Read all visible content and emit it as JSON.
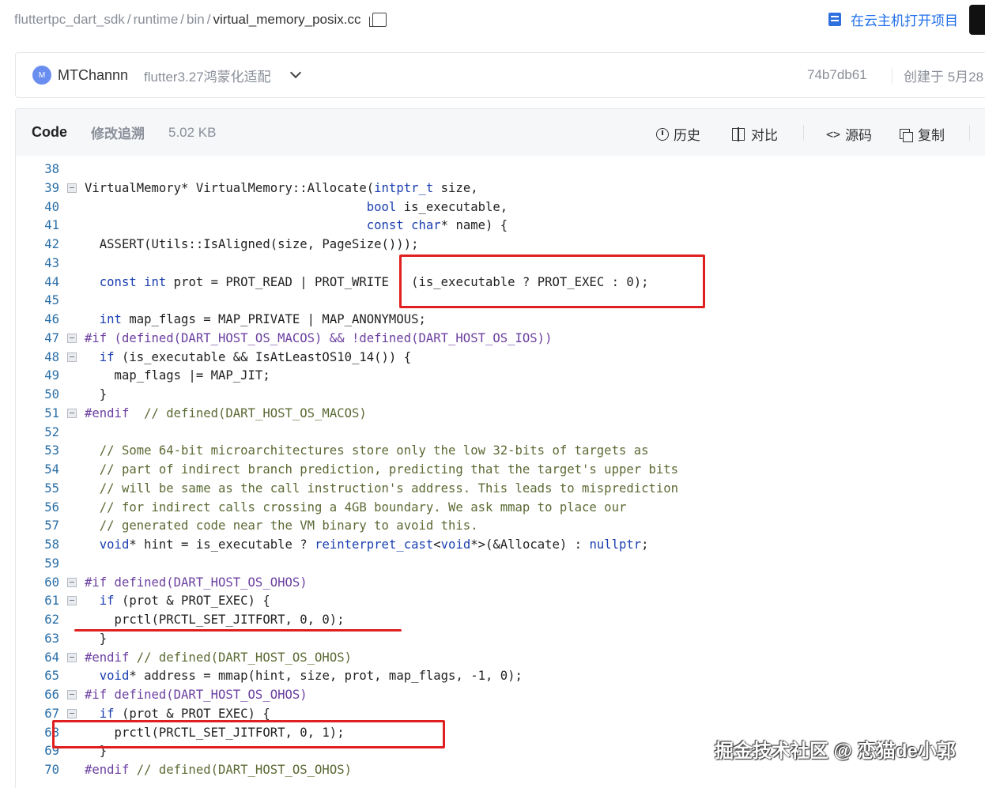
{
  "breadcrumb": [
    "fluttertpc_dart_sdk",
    "runtime",
    "bin"
  ],
  "file_name": "virtual_memory_posix.cc",
  "open_cloud_label": "在云主机打开项目",
  "commit": {
    "avatar_letter": "M",
    "author": "MTChannn",
    "message": "flutter3.27鸿蒙化适配",
    "hash": "74b7db61",
    "created": "创建于 5月28"
  },
  "file_header": {
    "tab_code": "Code",
    "tab_blame": "修改追溯",
    "size": "5.02 KB",
    "history_label": "历史",
    "compare_label": "对比",
    "source_label": "源码",
    "copy_label": "复制"
  },
  "code_lines": [
    {
      "n": "38",
      "t": ""
    },
    {
      "n": "39",
      "t": "VirtualMemory* VirtualMemory::Allocate(intptr_t size,"
    },
    {
      "n": "40",
      "t": "                                      bool is_executable,"
    },
    {
      "n": "41",
      "t": "                                      const char* name) {"
    },
    {
      "n": "42",
      "t": "  ASSERT(Utils::IsAligned(size, PageSize()));"
    },
    {
      "n": "43",
      "t": ""
    },
    {
      "n": "44",
      "t": "  const int prot = PROT_READ | PROT_WRITE | (is_executable ? PROT_EXEC : 0);"
    },
    {
      "n": "45",
      "t": ""
    },
    {
      "n": "46",
      "t": "  int map_flags = MAP_PRIVATE | MAP_ANONYMOUS;"
    },
    {
      "n": "47",
      "t": "#if (defined(DART_HOST_OS_MACOS) && !defined(DART_HOST_OS_IOS))"
    },
    {
      "n": "48",
      "t": "  if (is_executable && IsAtLeastOS10_14()) {"
    },
    {
      "n": "49",
      "t": "    map_flags |= MAP_JIT;"
    },
    {
      "n": "50",
      "t": "  }"
    },
    {
      "n": "51",
      "t": "#endif  // defined(DART_HOST_OS_MACOS)"
    },
    {
      "n": "52",
      "t": ""
    },
    {
      "n": "53",
      "t": "  // Some 64-bit microarchitectures store only the low 32-bits of targets as"
    },
    {
      "n": "54",
      "t": "  // part of indirect branch prediction, predicting that the target's upper bits"
    },
    {
      "n": "55",
      "t": "  // will be same as the call instruction's address. This leads to misprediction"
    },
    {
      "n": "56",
      "t": "  // for indirect calls crossing a 4GB boundary. We ask mmap to place our"
    },
    {
      "n": "57",
      "t": "  // generated code near the VM binary to avoid this."
    },
    {
      "n": "58",
      "t": "  void* hint = is_executable ? reinterpret_cast<void*>(&Allocate) : nullptr;"
    },
    {
      "n": "59",
      "t": ""
    },
    {
      "n": "60",
      "t": "#if defined(DART_HOST_OS_OHOS)"
    },
    {
      "n": "61",
      "t": "  if (prot & PROT_EXEC) {"
    },
    {
      "n": "62",
      "t": "    prctl(PRCTL_SET_JITFORT, 0, 0);"
    },
    {
      "n": "63",
      "t": "  }"
    },
    {
      "n": "64",
      "t": "#endif // defined(DART_HOST_OS_OHOS)"
    },
    {
      "n": "65",
      "t": "  void* address = mmap(hint, size, prot, map_flags, -1, 0);"
    },
    {
      "n": "66",
      "t": "#if defined(DART_HOST_OS_OHOS)"
    },
    {
      "n": "67",
      "t": "  if (prot & PROT_EXEC) {"
    },
    {
      "n": "68",
      "t": "    prctl(PRCTL_SET_JITFORT, 0, 1);"
    },
    {
      "n": "69",
      "t": "  }"
    },
    {
      "n": "70",
      "t": "#endif // defined(DART_HOST_OS_OHOS)"
    }
  ],
  "watermark": "掘金技术社区 @ 恋猫de小郭"
}
